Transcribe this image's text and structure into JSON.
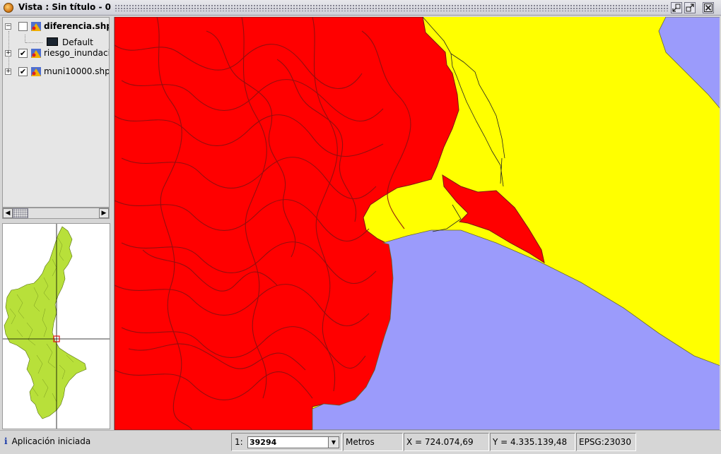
{
  "window": {
    "title": "Vista : Sin título - 0",
    "buttons": [
      "restore-icon",
      "maximize-icon",
      "close-icon"
    ]
  },
  "toc": {
    "layers": [
      {
        "name": "diferencia.shp",
        "checked": false,
        "expanded": true,
        "bold": true
      },
      {
        "name": "riesgo_inundaci",
        "checked": true,
        "expanded": false,
        "bold": false
      },
      {
        "name": "muni10000.shp",
        "checked": true,
        "expanded": false,
        "bold": false
      }
    ],
    "legend_label": "Default"
  },
  "status": {
    "message": "Aplicación iniciada",
    "scale_prefix": "1:",
    "scale_value": "39294",
    "units": "Metros",
    "x": "X = 724.074,69",
    "y": "Y = 4.335.139,48",
    "epsg": "EPSG:23030"
  },
  "colors": {
    "flood_zone": "#ff0000",
    "municipality": "#ffff00",
    "sea": "#9b9bfb",
    "overview_fill": "#b8e03a",
    "outline": "#7a1414"
  }
}
